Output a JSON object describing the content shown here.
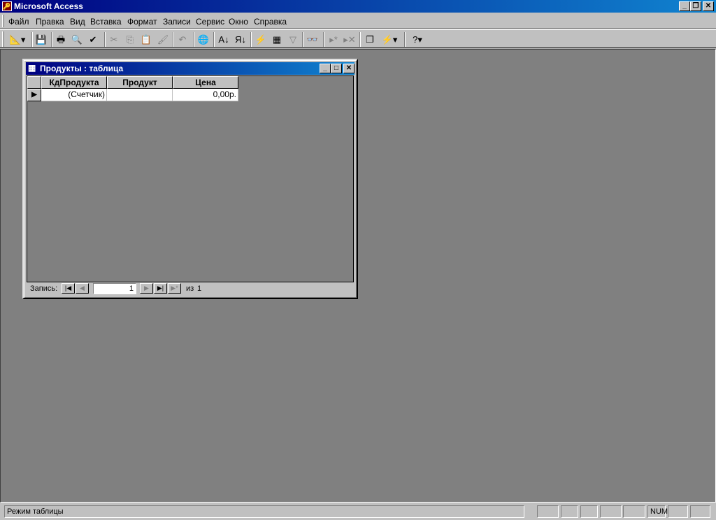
{
  "app": {
    "title": "Microsoft Access"
  },
  "menu": [
    "Файл",
    "Правка",
    "Вид",
    "Вставка",
    "Формат",
    "Записи",
    "Сервис",
    "Окно",
    "Справка"
  ],
  "toolbar": [
    {
      "name": "view-button",
      "glyph": "📐▾"
    },
    {
      "name": "save-button",
      "glyph": "💾"
    },
    {
      "name": "print-button",
      "glyph": "🖶"
    },
    {
      "name": "print-preview-button",
      "glyph": "🔍"
    },
    {
      "name": "spelling-button",
      "glyph": "✔"
    },
    {
      "name": "cut-button",
      "glyph": "✂",
      "dis": true
    },
    {
      "name": "copy-button",
      "glyph": "⎘",
      "dis": true
    },
    {
      "name": "paste-button",
      "glyph": "📋",
      "dis": true
    },
    {
      "name": "format-painter-button",
      "glyph": "🖌",
      "dis": true
    },
    {
      "name": "undo-button",
      "glyph": "↶",
      "dis": true
    },
    {
      "name": "hyperlink-button",
      "glyph": "🌐",
      "dis": true
    },
    {
      "name": "sort-ascending-button",
      "glyph": "А↓"
    },
    {
      "name": "sort-descending-button",
      "glyph": "Я↓"
    },
    {
      "name": "filter-by-selection-button",
      "glyph": "⚡"
    },
    {
      "name": "filter-by-form-button",
      "glyph": "▦"
    },
    {
      "name": "apply-filter-button",
      "glyph": "▽",
      "dis": true
    },
    {
      "name": "find-button",
      "glyph": "👓"
    },
    {
      "name": "new-record-button",
      "glyph": "▸*",
      "dis": true
    },
    {
      "name": "delete-record-button",
      "glyph": "▸✕",
      "dis": true
    },
    {
      "name": "database-window-button",
      "glyph": "❐"
    },
    {
      "name": "new-object-button",
      "glyph": "⚡▾"
    },
    {
      "name": "help-button",
      "glyph": "?▾"
    }
  ],
  "window": {
    "title": "Продукты : таблица",
    "columns": [
      "КдПродукта",
      "Продукт",
      "Цена"
    ],
    "rows": [
      [
        "(Счетчик)",
        "",
        "0,00р."
      ]
    ],
    "nav": {
      "label": "Запись:",
      "current": "1",
      "of_label": "из",
      "total": "1"
    }
  },
  "status": {
    "text": "Режим таблицы",
    "num": "NUM"
  }
}
